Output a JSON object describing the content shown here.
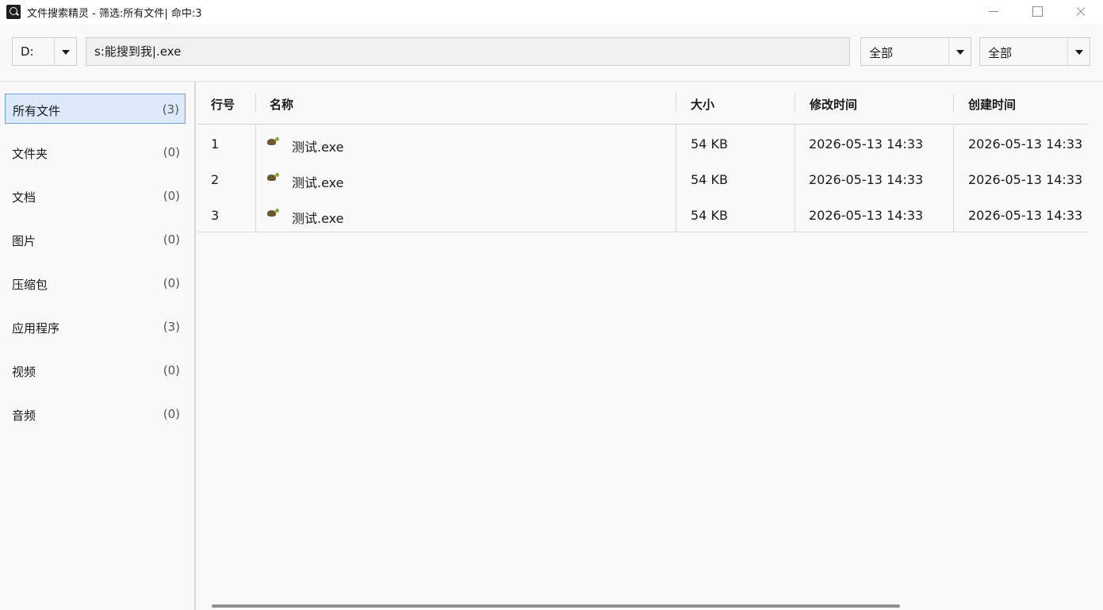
{
  "window": {
    "title": "文件搜索精灵 - 筛选:所有文件| 命中:3"
  },
  "toolbar": {
    "drive": "D:",
    "search_value": "s:能搜到我|.exe",
    "filter1": "全部",
    "filter2": "全部"
  },
  "sidebar": {
    "items": [
      {
        "label": "所有文件",
        "count": "(3)"
      },
      {
        "label": "文件夹",
        "count": "(0)"
      },
      {
        "label": "文档",
        "count": "(0)"
      },
      {
        "label": "图片",
        "count": "(0)"
      },
      {
        "label": "压缩包",
        "count": "(0)"
      },
      {
        "label": "应用程序",
        "count": "(3)"
      },
      {
        "label": "视频",
        "count": "(0)"
      },
      {
        "label": "音频",
        "count": "(0)"
      }
    ]
  },
  "table": {
    "columns": [
      "行号",
      "名称",
      "大小",
      "修改时间",
      "创建时间"
    ],
    "rows": [
      {
        "no": "1",
        "name": "测试.exe",
        "size": "54 KB",
        "modified": "2026-05-13 14:33",
        "created": "2026-05-13 14:33",
        "icon": "turtle-exe-icon"
      },
      {
        "no": "2",
        "name": "测试.exe",
        "size": "54 KB",
        "modified": "2026-05-13 14:33",
        "created": "2026-05-13 14:33",
        "icon": "turtle-exe-icon"
      },
      {
        "no": "3",
        "name": "测试.exe",
        "size": "54 KB",
        "modified": "2026-05-13 14:33",
        "created": "2026-05-13 14:33",
        "icon": "turtle-exe-icon"
      }
    ]
  },
  "colors": {
    "selected_bg": "#dbe9f8",
    "selected_border": "#6fa3d9"
  }
}
